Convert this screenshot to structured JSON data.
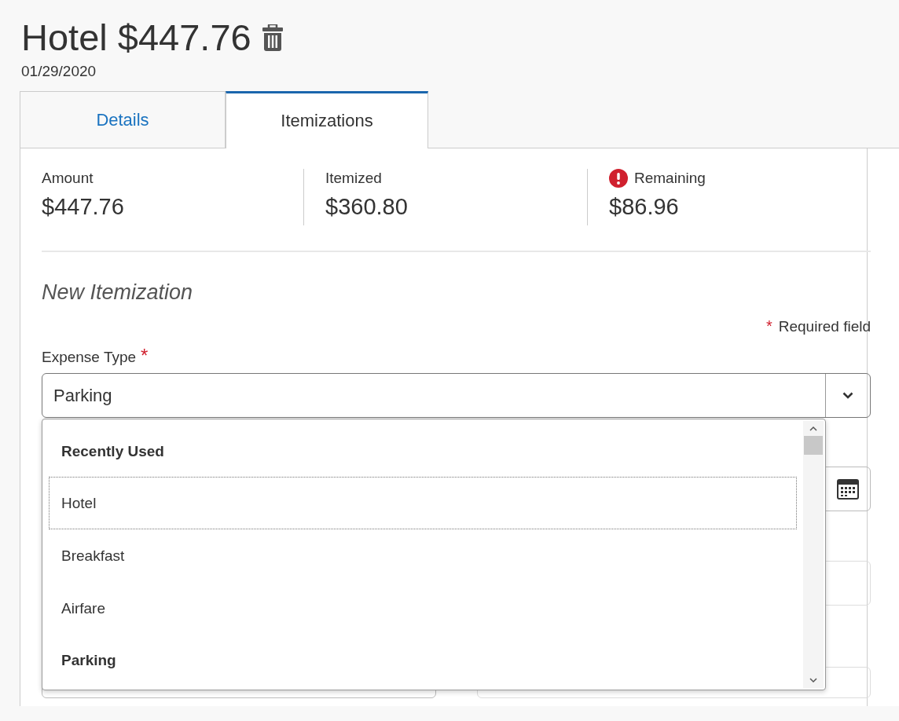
{
  "header": {
    "title": "Hotel $447.76",
    "date": "01/29/2020"
  },
  "tabs": [
    {
      "label": "Details",
      "selected": false
    },
    {
      "label": "Itemizations",
      "selected": true
    }
  ],
  "summary": [
    {
      "label": "Amount",
      "value": "$447.76",
      "warning": false
    },
    {
      "label": "Itemized",
      "value": "$360.80",
      "warning": false
    },
    {
      "label": "Remaining",
      "value": "$86.96",
      "warning": true
    }
  ],
  "section_title": "New Itemization",
  "required_note": {
    "mark": "*",
    "text": "Required field"
  },
  "expense_type": {
    "label": "Expense Type",
    "required_mark": "*",
    "value": "Parking",
    "expanded": true
  },
  "dropdown_items": [
    {
      "kind": "header",
      "label": "Recently Used"
    },
    {
      "kind": "option",
      "label": "Hotel",
      "focused": true
    },
    {
      "kind": "option",
      "label": "Breakfast",
      "focused": false
    },
    {
      "kind": "option",
      "label": "Airfare",
      "focused": false
    },
    {
      "kind": "header",
      "label": "Parking"
    }
  ]
}
